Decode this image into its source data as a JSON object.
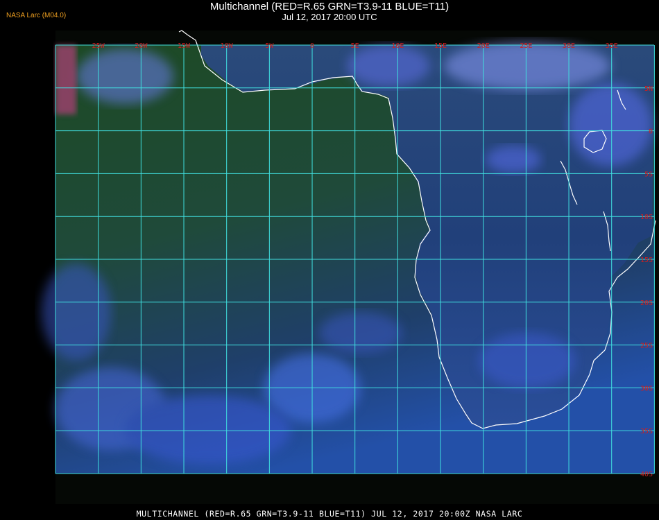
{
  "header": {
    "title": "Multichannel (RED=R.65 GRN=T3.9-11 BLUE=T11)",
    "subtitle": "Jul 12, 2017 20:00 UTC",
    "credit": "NASA Larc (M04.0)"
  },
  "footer": {
    "caption": "MULTICHANNEL (RED=R.65 GRN=T3.9-11 BLUE=T11) JUL 12, 2017 20:00Z  NASA LARC"
  },
  "map": {
    "grid_color": "#40e0e0",
    "coast_color": "#ffffff",
    "label_color": "#d02020",
    "lon_labels": [
      "25W",
      "20W",
      "15W",
      "10W",
      "5W",
      "0",
      "5E",
      "10E",
      "15E",
      "20E",
      "25E",
      "30E",
      "35E"
    ],
    "lat_labels": [
      "5N",
      "0",
      "5S",
      "10S",
      "15S",
      "20S",
      "25S",
      "30S",
      "35S",
      "40S"
    ]
  }
}
